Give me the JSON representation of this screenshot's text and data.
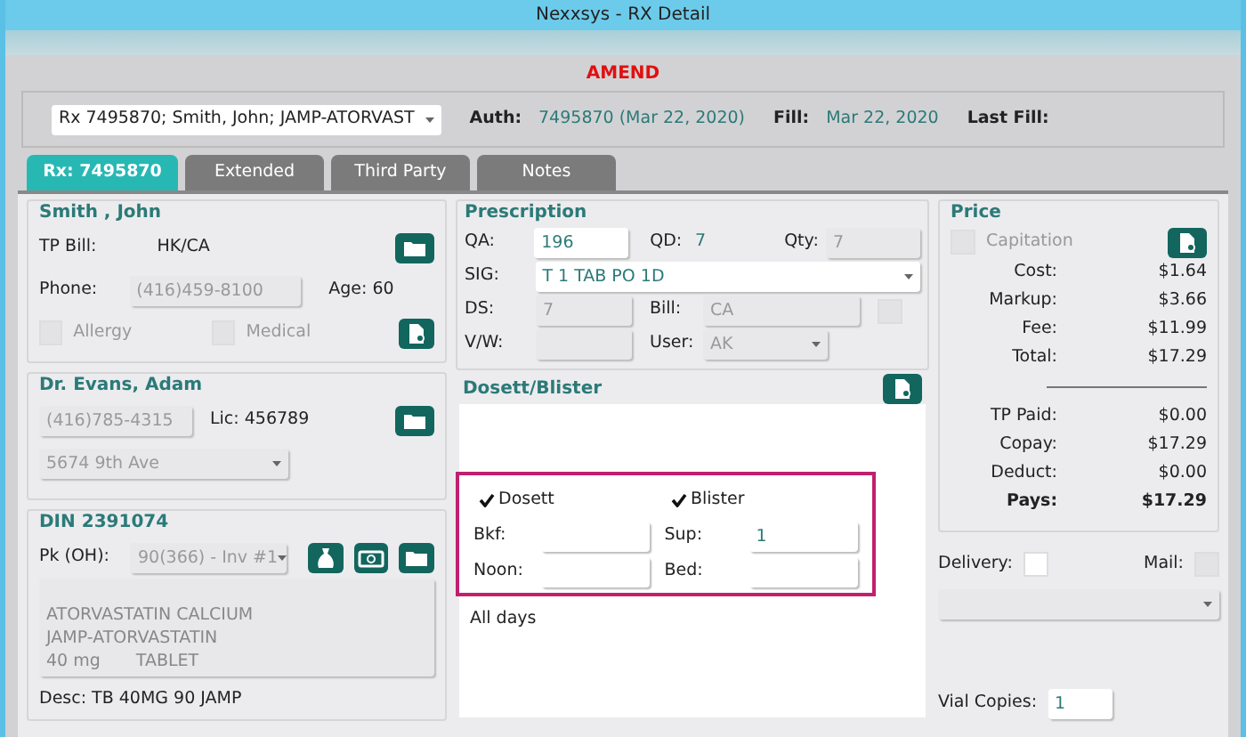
{
  "window": {
    "title": "Nexxsys - RX Detail"
  },
  "mode_label": "AMEND",
  "header": {
    "rx_select": "Rx 7495870; Smith, John; JAMP-ATORVAST",
    "fields": [
      {
        "label": "Auth:",
        "value": "7495870 (Mar 22, 2020)"
      },
      {
        "label": "Fill:",
        "value": "Mar 22, 2020"
      },
      {
        "label": "Last Fill:"
      }
    ]
  },
  "tabs": [
    {
      "label": "Rx: 7495870",
      "selected": true
    },
    {
      "label": "Extended",
      "selected": false
    },
    {
      "label": "Third Party",
      "selected": false
    },
    {
      "label": "Notes",
      "selected": false
    }
  ],
  "patient": {
    "name": "Smith , John",
    "tp_bill_label": "TP Bill:",
    "tp_bill": "HK/CA",
    "phone_label": "Phone:",
    "phone": "(416)459-8100",
    "age": "Age: 60",
    "checks": [
      {
        "label": "Allergy",
        "checked": false
      },
      {
        "label": "Medical",
        "checked": false
      }
    ]
  },
  "doctor": {
    "name": "Dr. Evans, Adam",
    "phone": "(416)785-4315",
    "license": "Lic: 456789",
    "address": "5674 9th Ave"
  },
  "drug": {
    "title": "DIN 2391074",
    "pack_label": "Pk (OH):",
    "pack": "90(366) - Inv #1",
    "lines": [
      [
        "ATORVASTATIN CALCIUM"
      ],
      [
        "JAMP-ATORVASTATIN"
      ],
      [
        "40 mg",
        "TABLET"
      ]
    ],
    "desc": "Desc: TB 40MG 90 JAMP"
  },
  "prescription": {
    "title": "Prescription",
    "qa_label": "QA:",
    "qa": "196",
    "qd_label": "QD:",
    "qd": "7",
    "qty_label": "Qty:",
    "qty": "7",
    "sig_label": "SIG:",
    "sig": "T 1 TAB PO 1D",
    "ds_label": "DS:",
    "ds": "7",
    "bill_label": "Bill:",
    "bill": "CA",
    "bill_check": false,
    "vw_label": "V/W:",
    "user_label": "User:",
    "user": "AK"
  },
  "dosett": {
    "title": "Dosett/Blister",
    "highlighted": true,
    "checks": [
      {
        "label": "Dosett",
        "checked": true
      },
      {
        "label": "Blister",
        "checked": true
      }
    ],
    "fields": [
      {
        "label": "Bkf:"
      },
      {
        "label": "Sup:",
        "value": "1"
      },
      {
        "label": "Noon:"
      },
      {
        "label": "Bed:"
      }
    ],
    "note": "All days"
  },
  "price": {
    "title": "Price",
    "capitation": {
      "label": "Capitation",
      "checked": false
    },
    "rows": [
      {
        "label": "Cost:",
        "value": "$1.64",
        "bold": false
      },
      {
        "label": "Markup:",
        "value": "$3.66",
        "bold": false
      },
      {
        "label": "Fee:",
        "value": "$11.99",
        "bold": false
      },
      {
        "label": "Total:",
        "value": "$17.29",
        "bold": false
      }
    ],
    "rows2": [
      {
        "label": "TP Paid:",
        "value": "$0.00",
        "bold": false
      },
      {
        "label": "Copay:",
        "value": "$17.29",
        "bold": false
      },
      {
        "label": "Deduct:",
        "value": "$0.00",
        "bold": false
      },
      {
        "label": "Pays:",
        "value": "$17.29",
        "bold": true
      }
    ]
  },
  "delivery": {
    "label": "Delivery:",
    "checked": false,
    "mail_label": "Mail:",
    "mail_checked": false
  },
  "vial_copies": {
    "label": "Vial Copies:",
    "value": "1"
  }
}
